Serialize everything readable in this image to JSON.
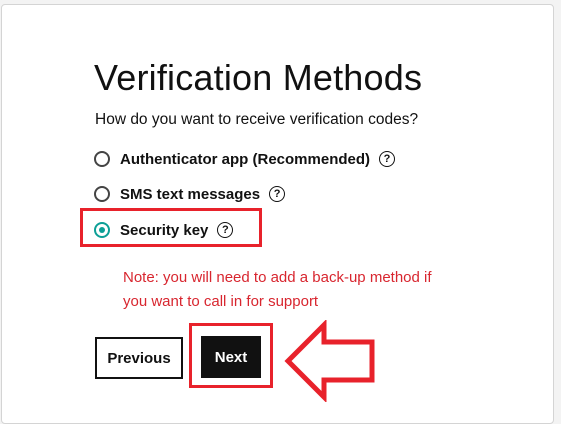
{
  "heading": "Verification Methods",
  "prompt": "How do you want to receive verification codes?",
  "options": [
    {
      "label": "Authenticator app (Recommended)",
      "selected": false,
      "help_icon": "question-circle-icon"
    },
    {
      "label": "SMS text messages",
      "selected": false,
      "help_icon": "question-circle-icon"
    },
    {
      "label": "Security key",
      "selected": true,
      "help_icon": "question-circle-icon"
    }
  ],
  "help_glyph": "?",
  "note": {
    "line1": "Note: you will need to add a back-up method if",
    "line2": "you want to call in for support"
  },
  "buttons": {
    "previous": "Previous",
    "next": "Next"
  },
  "colors": {
    "accent": "#0d9f96",
    "annotation": "#e8222b",
    "note_text": "#d8262f",
    "primary_button": "#111111"
  }
}
